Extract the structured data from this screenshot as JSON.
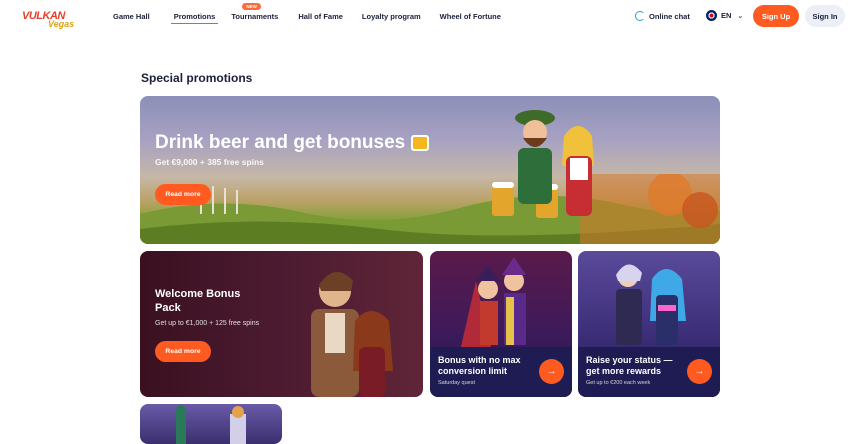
{
  "logo": {
    "line1": "VULKAN",
    "line2": "Vegas"
  },
  "nav": [
    {
      "label": "Game Hall"
    },
    {
      "label": "Promotions",
      "active": true
    },
    {
      "label": "Tournaments",
      "badge": "NEW"
    },
    {
      "label": "Hall of Fame"
    },
    {
      "label": "Loyalty program"
    },
    {
      "label": "Wheel of Fortune"
    }
  ],
  "header": {
    "chat_label": "Online chat",
    "lang": "EN",
    "signup_label": "Sign Up",
    "signin_label": "Sign In"
  },
  "section_title": "Special promotions",
  "hero": {
    "title": "Drink beer and get bonuses",
    "subtitle": "Get €9,000 + 385 free spins",
    "button": "Read more"
  },
  "welcome": {
    "title": "Welcome Bonus Pack",
    "subtitle": "Get up to €1,000 + 125 free spins",
    "button": "Read more"
  },
  "bonus_card": {
    "title": "Bonus with no max conversion limit",
    "subtitle": "Saturday quest"
  },
  "status_card": {
    "title": "Raise your status — get more rewards",
    "subtitle": "Get up to €200 each week"
  },
  "colors": {
    "accent": "#ff5a1f",
    "link": "#2b9cd8",
    "text": "#1c1f3a"
  },
  "icons": {
    "chat": "headset-icon",
    "lang": "uk-flag-icon",
    "arrow": "arrow-right-icon"
  }
}
